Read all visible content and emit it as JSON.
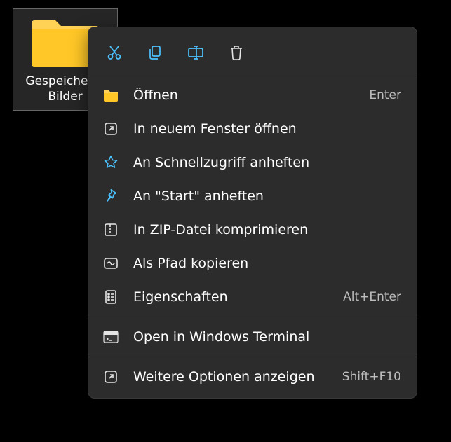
{
  "folder": {
    "label": "Gespeicherte Bilder"
  },
  "actionbar": {
    "cut": "cut",
    "copy": "copy",
    "rename": "rename",
    "delete": "delete"
  },
  "menu": {
    "open": {
      "label": "Öffnen",
      "shortcut": "Enter"
    },
    "open_new_window": {
      "label": "In neuem Fenster öffnen"
    },
    "pin_quick": {
      "label": "An Schnellzugriff anheften"
    },
    "pin_start": {
      "label": "An \"Start\" anheften"
    },
    "zip": {
      "label": "In ZIP-Datei komprimieren"
    },
    "copy_path": {
      "label": "Als Pfad kopieren"
    },
    "properties": {
      "label": "Eigenschaften",
      "shortcut": "Alt+Enter"
    },
    "terminal": {
      "label": "Open in Windows Terminal"
    },
    "more": {
      "label": "Weitere Optionen anzeigen",
      "shortcut": "Shift+F10"
    }
  }
}
